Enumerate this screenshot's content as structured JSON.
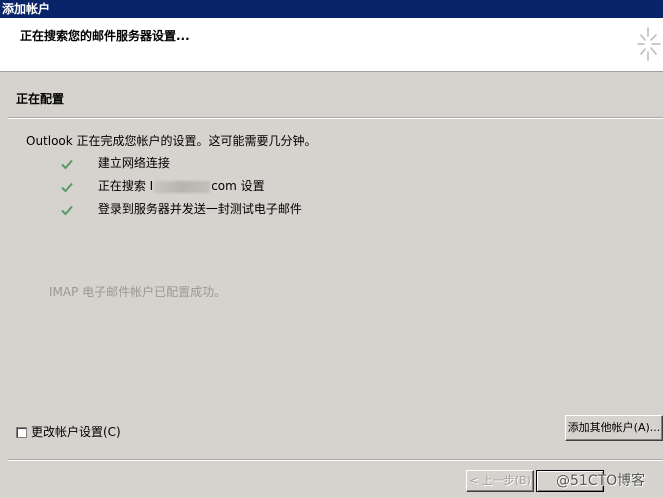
{
  "window": {
    "title": "添加帐户"
  },
  "header": {
    "title": "正在搜索您的邮件服务器设置..."
  },
  "section": {
    "title": "正在配置"
  },
  "status": {
    "message": "Outlook 正在完成您帐户的设置。这可能需要几分钟。"
  },
  "tasks": [
    {
      "label": "建立网络连接",
      "done": true
    },
    {
      "prefix": "正在搜索 I",
      "suffix": "com 设置",
      "done": true
    },
    {
      "label": "登录到服务器并发送一封测试电子邮件",
      "done": true
    }
  ],
  "result": {
    "message": "IMAP 电子邮件帐户已配置成功。"
  },
  "options": {
    "change_settings_label": "更改帐户设置(C)",
    "change_settings_checked": false
  },
  "buttons": {
    "add_other_label": "添加其他帐户(A)...",
    "back_label": "< 上一步(B)",
    "next_label": ""
  },
  "watermark": {
    "text": "@51CTO博客"
  },
  "colors": {
    "titlebar": "#0a246a",
    "check": "#5a9a6a",
    "muted_text": "#9a9892"
  }
}
